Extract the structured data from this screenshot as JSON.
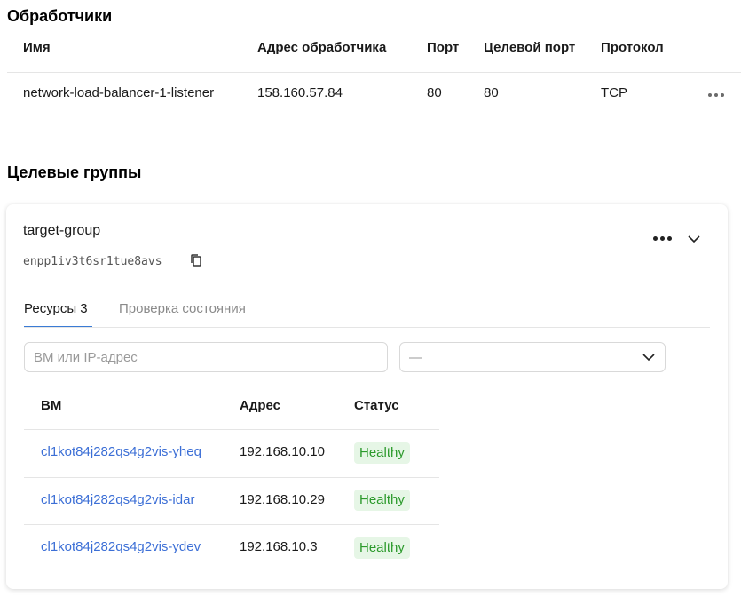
{
  "listeners": {
    "title": "Обработчики",
    "columns": [
      "Имя",
      "Адрес обработчика",
      "Порт",
      "Целевой порт",
      "Протокол"
    ],
    "rows": [
      {
        "name": "network-load-balancer-1-listener",
        "address": "158.160.57.84",
        "port": "80",
        "target_port": "80",
        "protocol": "TCP"
      }
    ]
  },
  "target_groups": {
    "title": "Целевые группы",
    "group": {
      "name": "target-group",
      "id": "enpp1iv3t6sr1tue8avs",
      "tabs": [
        {
          "label": "Ресурсы 3",
          "active": true
        },
        {
          "label": "Проверка состояния",
          "active": false
        }
      ],
      "search_placeholder": "ВМ или IP-адрес",
      "select_value": "—",
      "columns": [
        "ВМ",
        "Адрес",
        "Статус"
      ],
      "rows": [
        {
          "vm": "cl1kot84j282qs4g2vis-yheq",
          "address": "192.168.10.10",
          "status": "Healthy"
        },
        {
          "vm": "cl1kot84j282qs4g2vis-idar",
          "address": "192.168.10.29",
          "status": "Healthy"
        },
        {
          "vm": "cl1kot84j282qs4g2vis-ydev",
          "address": "192.168.10.3",
          "status": "Healthy"
        }
      ]
    }
  },
  "colors": {
    "link": "#3c6fd6",
    "healthy_bg": "#e6f6e6",
    "healthy_text": "#2c9a2c",
    "tab_accent": "#3a7bd5"
  },
  "icons": [
    "more-horizontal-icon",
    "chevron-down-icon",
    "copy-icon"
  ]
}
